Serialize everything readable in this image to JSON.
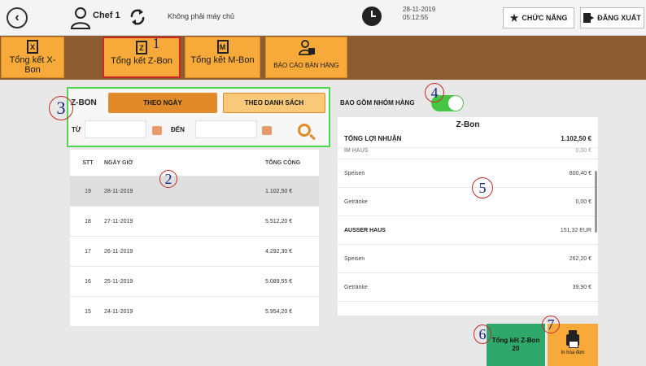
{
  "topbar": {
    "user_name": "Chef 1",
    "server_status": "Không phải máy chủ",
    "date": "28-11-2019",
    "time": "05:12:55",
    "functions_label": "CHỨC NĂNG",
    "logout_label": "ĐĂNG XUẤT"
  },
  "nav": {
    "items": [
      {
        "label": "Tổng kết X-Bon",
        "icon_letter": "X"
      },
      {
        "label": "Tổng kết Z-Bon",
        "icon_letter": "Z"
      },
      {
        "label": "Tổng kết M-Bon",
        "icon_letter": "M"
      },
      {
        "label": "BÁO CÁO BÁN HÀNG",
        "icon_letter": ""
      }
    ]
  },
  "filter": {
    "title": "Z-BON",
    "tab_by_date": "THEO NGÀY",
    "tab_by_list": "THEO DANH SÁCH",
    "from_label": "TỪ",
    "to_label": "ĐẾN",
    "from_value": "",
    "to_value": ""
  },
  "table": {
    "headers": [
      "STT",
      "NGÀY GIỜ",
      "TỔNG CỘNG"
    ],
    "rows": [
      {
        "stt": "19",
        "date": "28-11-2019",
        "total": "1.102,50 €"
      },
      {
        "stt": "18",
        "date": "27-11-2019",
        "total": "5.512,20 €"
      },
      {
        "stt": "17",
        "date": "26-11-2019",
        "total": "4.292,30 €"
      },
      {
        "stt": "16",
        "date": "25-11-2019",
        "total": "5.089,55 €"
      },
      {
        "stt": "15",
        "date": "24-11-2019",
        "total": "5.954,20 €"
      }
    ]
  },
  "summary": {
    "include_groups_label": "BAO GỒM NHÓM HÀNG",
    "include_groups_on": true,
    "title": "Z-Bon",
    "profit_label": "TỔNG LỢI NHUẬN",
    "profit_value": "1.102,50 €",
    "rows": [
      {
        "label": "IM HAUS",
        "value": "0,00 €",
        "bold": false,
        "cut": true
      },
      {
        "label": "Speisen",
        "value": "800,40 €",
        "bold": false,
        "cut": false
      },
      {
        "label": "Getränke",
        "value": "0,00 €",
        "bold": false,
        "cut": false
      },
      {
        "label": "AUSSER HAUS",
        "value": "151,32 EUR",
        "bold": true,
        "cut": false
      },
      {
        "label": "Speisen",
        "value": "262,20 €",
        "bold": false,
        "cut": false
      },
      {
        "label": "Getränke",
        "value": "39,90 €",
        "bold": false,
        "cut": false
      }
    ]
  },
  "actions": {
    "zbon_total_line1": "Tổng kết Z-Bon",
    "zbon_total_line2": "20",
    "print_label": "In hóa đơn"
  },
  "annotations": [
    "1",
    "2",
    "3",
    "4",
    "5",
    "6",
    "7"
  ],
  "colors": {
    "nav_bar": "#8c5b2f",
    "nav_button": "#f7a93a",
    "active_tab": "#e08a2a",
    "toggle_on": "#43c743",
    "zbon_button": "#2ea96b"
  }
}
